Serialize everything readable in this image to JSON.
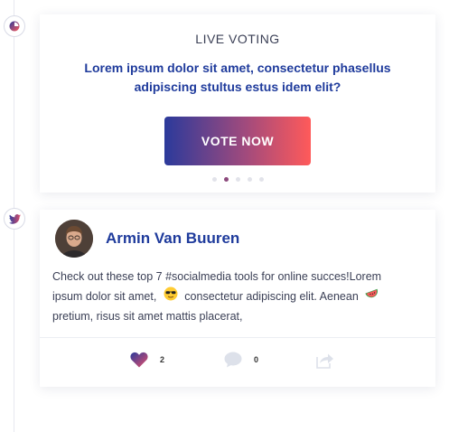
{
  "voting": {
    "heading": "LIVE VOTING",
    "question": "Lorem ipsum dolor sit amet, consectetur phasellus adipiscing stultus estus idem elit?",
    "button_label": "VOTE NOW",
    "pager": {
      "total": 5,
      "active_index": 1
    }
  },
  "post": {
    "author": "Armin Van Buuren",
    "text_part1": "Check out these top 7 #socialmedia tools for online succes!Lorem ipsum dolor sit amet,",
    "text_part2": "consectetur adipiscing elit. Aenean",
    "text_part3": "pretium, risus sit amet mattis placerat,",
    "likes": "2",
    "comments": "0"
  },
  "icons": {
    "voting_marker": "poll-icon",
    "twitter_marker": "twitter-icon",
    "emoji_1": "sunglasses-emoji",
    "emoji_2": "watermelon-emoji",
    "like": "heart-icon",
    "comment": "comment-icon",
    "share": "share-icon"
  },
  "colors": {
    "accent_blue": "#1f3b9c",
    "gradient_start": "#2b3a9b",
    "gradient_end": "#ff5a5a"
  }
}
